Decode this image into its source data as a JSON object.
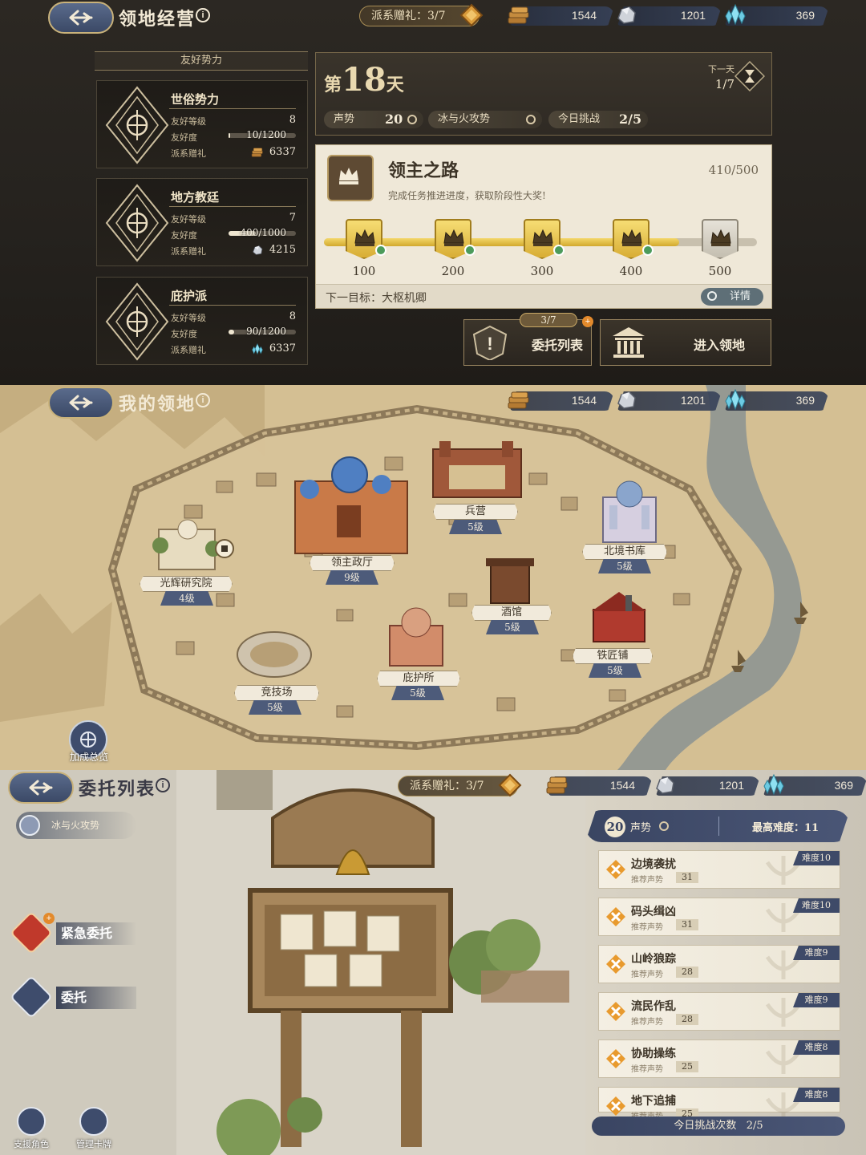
{
  "resources": {
    "wood": "1544",
    "ore": "1201",
    "crystal": "369"
  },
  "panel1": {
    "title": "领地经营",
    "gift": "派系赠礼：3/7",
    "faction_header": "友好势力",
    "factions": [
      {
        "name": "世俗势力",
        "level_label": "友好等级",
        "level": "8",
        "friend_label": "友好度",
        "friend": "10/1200",
        "friend_ratio": 0.01,
        "gift_label": "派系赠礼",
        "gift": "6337",
        "gift_icon": "wood-icon"
      },
      {
        "name": "地方教廷",
        "level_label": "友好等级",
        "level": "7",
        "friend_label": "友好度",
        "friend": "400/1000",
        "friend_ratio": 0.4,
        "gift_label": "派系赠礼",
        "gift": "4215",
        "gift_icon": "ore-icon"
      },
      {
        "name": "庇护派",
        "level_label": "友好等级",
        "level": "8",
        "friend_label": "友好度",
        "friend": "90/1200",
        "friend_ratio": 0.075,
        "gift_label": "派系赠礼",
        "gift": "6337",
        "gift_icon": "crystal-icon"
      }
    ],
    "day": {
      "prefix": "第",
      "num": "18",
      "suffix": "天",
      "next_label": "下一天",
      "next_count": "1/7"
    },
    "stats": {
      "prestige_label": "声势",
      "prestige": "20",
      "region": "冰与火攻势",
      "challenge_label": "今日挑战",
      "challenge": "2/5"
    },
    "lord_road": {
      "title": "领主之路",
      "subtitle": "完成任务推进进度，获取阶段性大奖!",
      "progress": "410/500",
      "progress_ratio": 0.82,
      "milestones": [
        {
          "label": "100",
          "done": true
        },
        {
          "label": "200",
          "done": true
        },
        {
          "label": "300",
          "done": true
        },
        {
          "label": "400",
          "done": true
        },
        {
          "label": "500",
          "done": false
        }
      ],
      "next_goal_label": "下一目标：",
      "next_goal": "大枢机卿",
      "detail": "详情"
    },
    "commission_btn": {
      "label": "委托列表",
      "count": "3/7"
    },
    "enter_btn": {
      "label": "进入领地"
    }
  },
  "panel2": {
    "title": "我的领地",
    "buildings": [
      {
        "name": "兵营",
        "level": "5级"
      },
      {
        "name": "领主政厅",
        "level": "9级"
      },
      {
        "name": "光辉研究院",
        "level": "4级"
      },
      {
        "name": "北境书库",
        "level": "5级"
      },
      {
        "name": "酒馆",
        "level": "5级"
      },
      {
        "name": "铁匠铺",
        "level": "5级"
      },
      {
        "name": "竞技场",
        "level": "5级"
      },
      {
        "name": "庇护所",
        "level": "5级"
      }
    ],
    "overview": "加成总览"
  },
  "panel3": {
    "title": "委托列表",
    "gift": "派系赠礼：3/7",
    "region": "冰与火攻势",
    "menu": [
      {
        "label": "紧急委托"
      },
      {
        "label": "委托"
      }
    ],
    "tools": [
      {
        "label": "支援角色"
      },
      {
        "label": "管理卡牌"
      }
    ],
    "header": {
      "prestige": "20",
      "prestige_label": "声势",
      "max_diff": "最高难度：11"
    },
    "quests": [
      {
        "name": "边境袭扰",
        "rec_label": "推荐声势",
        "rec": "31",
        "diff": "难度10"
      },
      {
        "name": "码头缉凶",
        "rec_label": "推荐声势",
        "rec": "31",
        "diff": "难度10"
      },
      {
        "name": "山岭狼踪",
        "rec_label": "推荐声势",
        "rec": "28",
        "diff": "难度9"
      },
      {
        "name": "流民作乱",
        "rec_label": "推荐声势",
        "rec": "28",
        "diff": "难度9"
      },
      {
        "name": "协助操练",
        "rec_label": "推荐声势",
        "rec": "25",
        "diff": "难度8"
      },
      {
        "name": "地下追捕",
        "rec_label": "推荐声势",
        "rec": "25",
        "diff": "难度8"
      }
    ],
    "today_label": "今日挑战次数",
    "today": "2/5"
  },
  "colors": {
    "gold": "#d2a92e",
    "navy": "#3e4a68",
    "parchment": "#efe8d8",
    "urgent": "#c0392b"
  }
}
